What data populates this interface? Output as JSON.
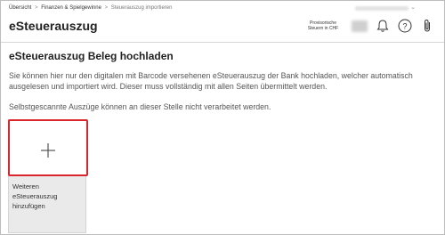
{
  "breadcrumb": {
    "items": [
      "Übersicht",
      "Finanzen & Spielgewinne",
      "Steuerauszug importieren"
    ],
    "separator": ">"
  },
  "header": {
    "app_title": "eSteuerauszug",
    "provisional_text": [
      "Provisorische",
      "Steuern in CHF"
    ],
    "icons": [
      "bell-icon",
      "help-icon",
      "attachment-icon"
    ]
  },
  "main": {
    "title": "eSteuerauszug Beleg hochladen",
    "description": "Sie können hier nur den digitalen mit Barcode versehenen eSteuerauszug der Bank hochladen, welcher automatisch ausgelesen und importiert wird. Dieser muss vollständig mit allen Seiten übermittelt werden.",
    "note": "Selbstgescannte Auszüge können an dieser Stelle nicht verarbeitet werden."
  },
  "upload_tile": {
    "label_lines": [
      "Weiteren",
      "eSteuerauszug",
      "hinzufügen"
    ],
    "icon": "plus-icon"
  },
  "colors": {
    "highlight": "#d9262c",
    "tile_bg": "#eaeaea",
    "text_muted": "#555555"
  }
}
